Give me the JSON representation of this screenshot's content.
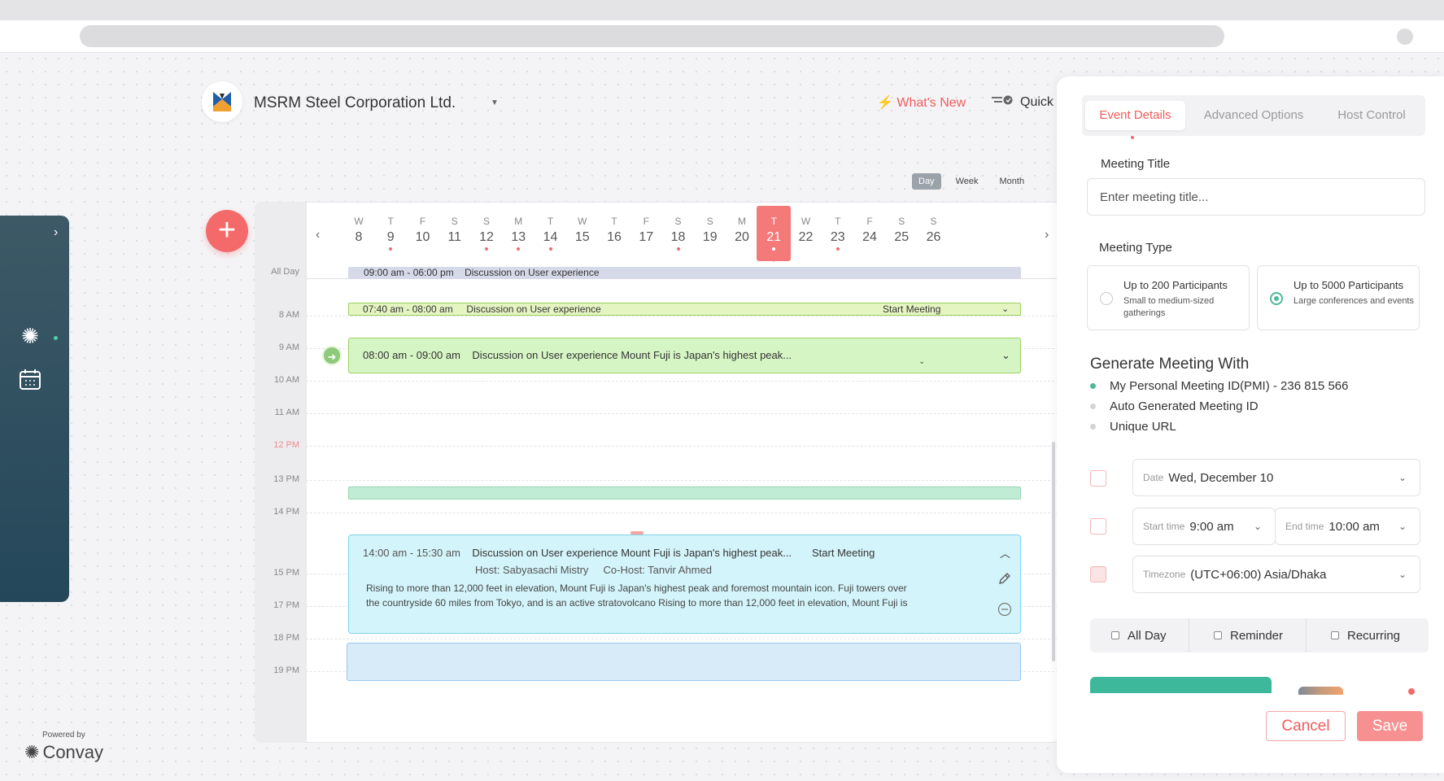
{
  "header": {
    "org_name": "MSRM Steel Corporation Ltd.",
    "whats_new": "What's New",
    "quick": "Quick"
  },
  "views": [
    "Day",
    "Week",
    "Month"
  ],
  "calendar": {
    "days": [
      {
        "w": "W",
        "n": "8",
        "dot": false
      },
      {
        "w": "T",
        "n": "9",
        "dot": true
      },
      {
        "w": "F",
        "n": "10",
        "dot": false
      },
      {
        "w": "S",
        "n": "11",
        "dot": false
      },
      {
        "w": "S",
        "n": "12",
        "dot": true
      },
      {
        "w": "M",
        "n": "13",
        "dot": true
      },
      {
        "w": "T",
        "n": "14",
        "dot": true
      },
      {
        "w": "W",
        "n": "15",
        "dot": false
      },
      {
        "w": "T",
        "n": "16",
        "dot": false
      },
      {
        "w": "F",
        "n": "17",
        "dot": false
      },
      {
        "w": "S",
        "n": "18",
        "dot": true
      },
      {
        "w": "S",
        "n": "19",
        "dot": false
      },
      {
        "w": "M",
        "n": "20",
        "dot": false
      },
      {
        "w": "T",
        "n": "21",
        "dot": true,
        "today": true
      },
      {
        "w": "W",
        "n": "22",
        "dot": false
      },
      {
        "w": "T",
        "n": "23",
        "dot": true
      },
      {
        "w": "F",
        "n": "24",
        "dot": false
      },
      {
        "w": "S",
        "n": "25",
        "dot": false
      },
      {
        "w": "S",
        "n": "26",
        "dot": false
      }
    ],
    "times": [
      "All Day",
      "8 AM",
      "9 AM",
      "10 AM",
      "11 AM",
      "12 PM",
      "13 PM",
      "14 PM",
      "15 PM",
      "17 PM",
      "18 PM",
      "19 PM"
    ],
    "events": {
      "allday": {
        "time": "09:00 am - 06:00 pm",
        "title": "Discussion on  User experience"
      },
      "e1": {
        "time": "07:40 am - 08:00 am",
        "title": "Discussion on  User experience",
        "action": "Start Meeting"
      },
      "e2": {
        "time": "08:00 am - 09:00 am",
        "title": "Discussion on  User experience  Mount Fuji is Japan's highest peak..."
      },
      "e4": {
        "time": "14:00 am - 15:30 am",
        "title": "Discussion on  User experience  Mount Fuji is Japan's highest peak...",
        "action": "Start Meeting",
        "host": "Host: Sabyasachi Mistry",
        "cohost": "Co-Host: Tanvir Ahmed",
        "desc1": "Rising to more than 12,000 feet in elevation, Mount Fuji is Japan's highest peak and foremost mountain icon. Fuji towers over",
        "desc2": "the countryside 60 miles from Tokyo, and is an active stratovolcano Rising to more than 12,000 feet in elevation, Mount Fuji is"
      }
    }
  },
  "sidebar": {
    "powered_by": "Powered by",
    "brand": "Convay"
  },
  "panel": {
    "tabs": [
      "Event Details",
      "Advanced Options",
      "Host Control"
    ],
    "meeting_title_label": "Meeting Title",
    "meeting_title_placeholder": "Enter meeting title...",
    "meeting_type_label": "Meeting Type",
    "types": [
      {
        "title": "Up to 200 Participants",
        "sub": "Small to medium-sized gatherings",
        "selected": false
      },
      {
        "title": "Up to 5000 Participants",
        "sub": "Large conferences and events",
        "selected": true
      }
    ],
    "generate_title": "Generate Meeting With",
    "generate_options": [
      "My Personal Meeting ID(PMI) - 236 815 566",
      "Auto Generated Meeting ID",
      "Unique URL"
    ],
    "date_label": "Date",
    "date_value": "Wed, December 10",
    "start_label": "Start time",
    "start_value": "9:00 am",
    "end_label": "End time",
    "end_value": "10:00 am",
    "tz_label": "Timezone",
    "tz_value": "(UTC+06:00) Asia/Dhaka",
    "checks": [
      "All Day",
      "Reminder",
      "Recurring"
    ],
    "cancel": "Cancel",
    "save": "Save"
  },
  "colors": {
    "accent": "#f46a6a",
    "teal": "#3db89a",
    "nav": "#2a4a5c"
  }
}
